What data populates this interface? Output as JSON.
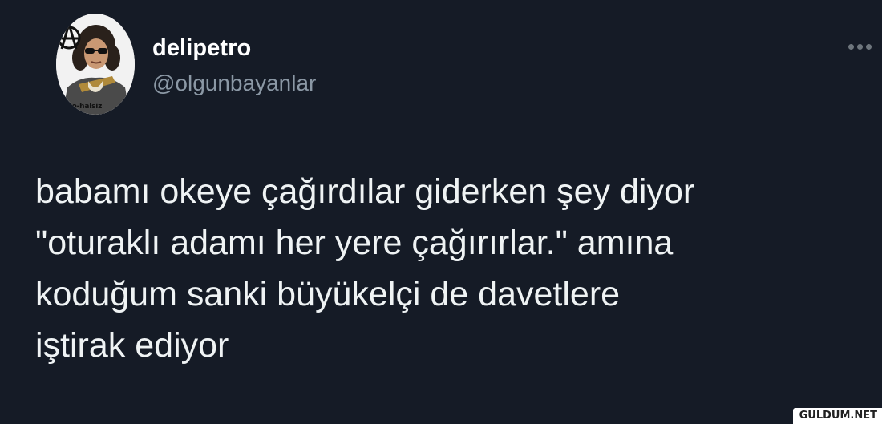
{
  "tweet": {
    "author": {
      "display_name": "delipetro",
      "handle": "@olgunbayanlar",
      "avatar_caption": "arko-halsiz",
      "avatar_icon": "anarchy-icon"
    },
    "more_icon": "more-horizontal-icon",
    "text_lines": [
      "babamı okeye çağırdılar giderken şey diyor",
      "\"oturaklı adamı her yere çağırırlar.\" amına",
      "koduğum sanki büyükelçi de davetlere",
      "iştirak ediyor"
    ]
  },
  "watermark": "GULDUM.NET",
  "colors": {
    "background": "#151b26",
    "text": "#eff3f4",
    "secondary_text": "#8b98a5",
    "display_name": "#ffffff"
  }
}
